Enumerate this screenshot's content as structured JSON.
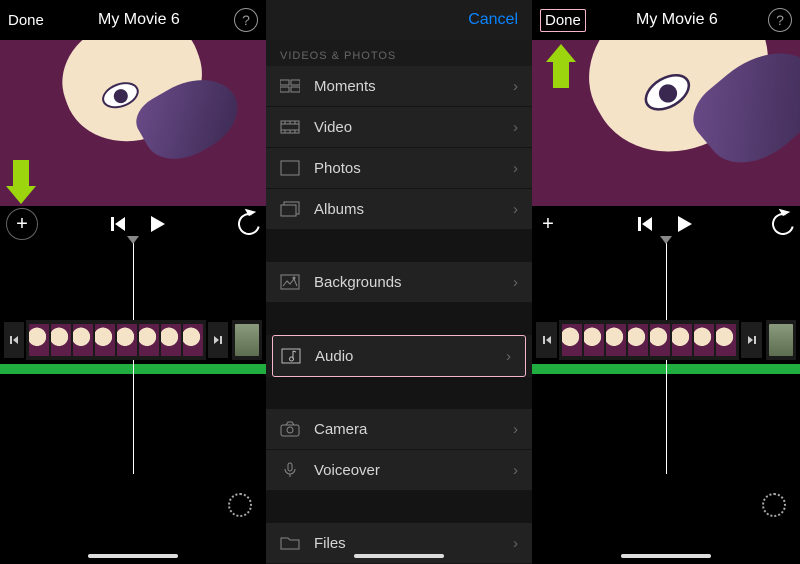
{
  "header": {
    "done": "Done",
    "title": "My Movie 6"
  },
  "picker": {
    "cancel": "Cancel",
    "section_label": "VIDEOS & PHOTOS",
    "items": {
      "moments": "Moments",
      "video": "Video",
      "photos": "Photos",
      "albums": "Albums",
      "backgrounds": "Backgrounds",
      "audio": "Audio",
      "camera": "Camera",
      "voiceover": "Voiceover",
      "files": "Files"
    }
  }
}
